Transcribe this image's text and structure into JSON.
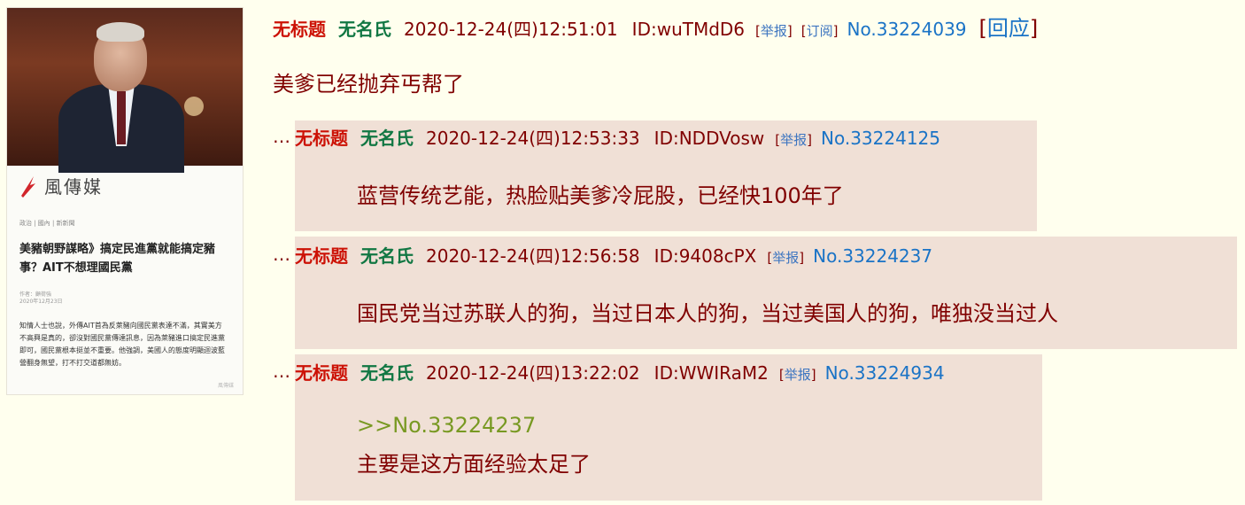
{
  "thumbnail": {
    "brand": "風傳媒",
    "crumb": "政治 | 國內 | 新新聞",
    "headline": "美豬朝野謀略》搞定民進黨就能搞定豬事？AIT不想理國民黨",
    "author": "作者：顧荷強\n2020年12月23日",
    "body": "知情人士也說，外傳AIT首為反萊豬向國民黨表達不滿，其實美方不高興是真的，卻沒對國民黨傳達訊息，因為萊豬進口搞定民進黨即可，國民黨根本挺並不重要。他強調，美國人的態度明顯迴波藍營翻身無望，打不打交道都無妨。",
    "watermark": "風傳媒"
  },
  "op": {
    "title": "无标题",
    "name": "无名氏",
    "datetime": "2020-12-24(四)12:51:01",
    "id": "ID:wuTMdD6",
    "report": "举报",
    "subscribe": "订阅",
    "no": "No.33224039",
    "reply_btn": "回应",
    "content": "美爹已经抛弃丐帮了"
  },
  "replies": [
    {
      "title": "无标题",
      "name": "无名氏",
      "datetime": "2020-12-24(四)12:53:33",
      "id": "ID:NDDVosw",
      "report": "举报",
      "no": "No.33224125",
      "content": "蓝营传统艺能，热脸贴美爹冷屁股，已经快100年了"
    },
    {
      "title": "无标题",
      "name": "无名氏",
      "datetime": "2020-12-24(四)12:56:58",
      "id": "ID:9408cPX",
      "report": "举报",
      "no": "No.33224237",
      "content": "国民党当过苏联人的狗，当过日本人的狗，当过美国人的狗，唯独没当过人"
    },
    {
      "title": "无标题",
      "name": "无名氏",
      "datetime": "2020-12-24(四)13:22:02",
      "id": "ID:WWIRaM2",
      "report": "举报",
      "no": "No.33224934",
      "quote": ">>No.33224237",
      "content": "主要是这方面经验太足了"
    }
  ],
  "ellipsis": "…",
  "colors": {
    "background": "#ffffee",
    "reply_bg": "#f0e0d6",
    "title": "#cc1105",
    "name": "#117743",
    "text": "#800000",
    "link": "#1a73c6",
    "quote": "#789922"
  }
}
